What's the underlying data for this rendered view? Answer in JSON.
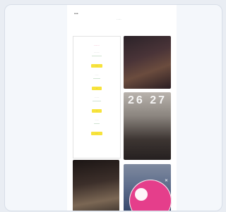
{
  "header": {
    "logo_small": "•••",
    "logo_mid": "·····"
  },
  "left_card": {
    "title": "·····",
    "blocks": [
      {
        "small": "··········",
        "heading": "··············",
        "button": "····"
      },
      {
        "small": "·······",
        "heading": "··········",
        "button": "···"
      },
      {
        "small": "········",
        "heading": "············",
        "button": "···"
      },
      {
        "small": "······",
        "heading": "········",
        "button": "····"
      }
    ]
  },
  "photos": {
    "p2_numbers": "26 27"
  },
  "colors": {
    "accent_pink": "#e53e8b",
    "title_pink": "#e0447b",
    "heading_green": "#2d7d32",
    "button_yellow": "#f7e33c"
  },
  "icons": {
    "close_badge": "close-icon"
  }
}
